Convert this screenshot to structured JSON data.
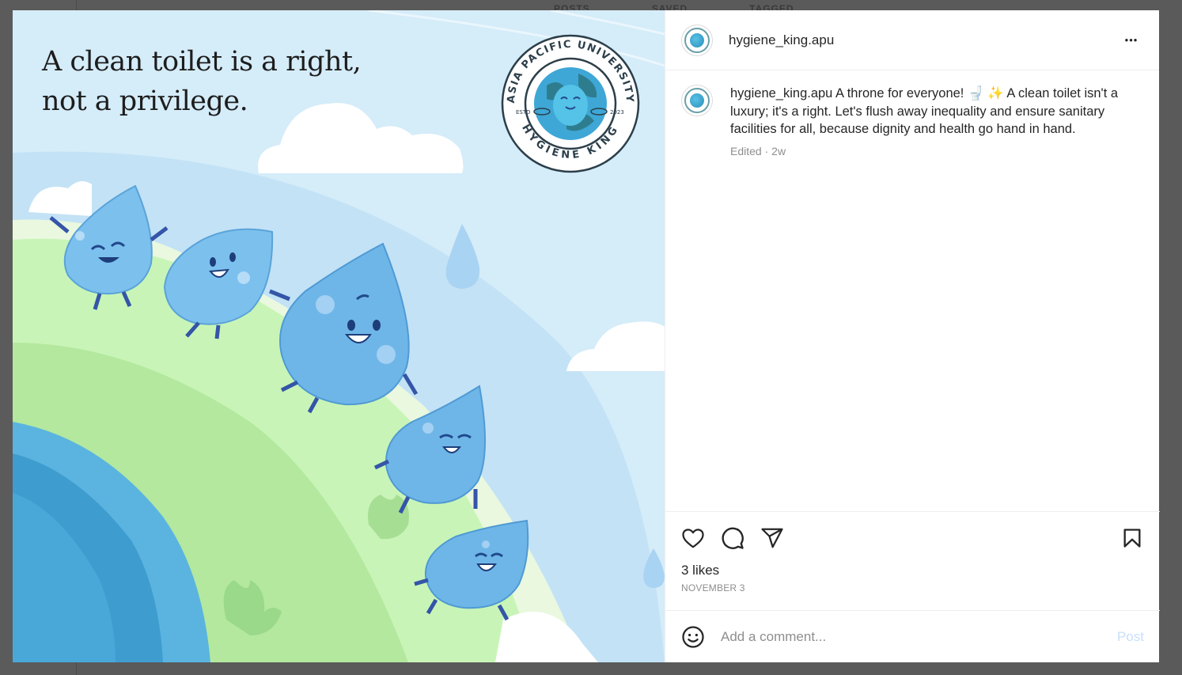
{
  "background": {
    "tabs": [
      "POSTS",
      "SAVED",
      "TAGGED"
    ]
  },
  "post": {
    "image": {
      "headline_line1": "A clean toilet is a right,",
      "headline_line2": "not a privilege.",
      "badge_top_text": "ASIA PACIFIC UNIVERSITY",
      "badge_bottom_text": "HYGIENE KING",
      "badge_left": "ESTD",
      "badge_right": "2023"
    },
    "header": {
      "username": "hygiene_king.apu",
      "more_label": "•••"
    },
    "caption": {
      "username": "hygiene_king.apu",
      "text": " A throne for everyone! 🚽 ✨ A clean toilet isn't a luxury; it's a right. Let's flush away inequality and ensure sanitary facilities for all, because dignity and health go hand in hand.",
      "edited": "Edited",
      "time": "2w"
    },
    "likes": "3 likes",
    "date": "NOVEMBER 3",
    "comment": {
      "placeholder": "Add a comment...",
      "post_label": "Post"
    }
  },
  "colors": {
    "sky": "#d3ebf8",
    "hill_green": "#b8ecb0",
    "drop_blue": "#6fb6e8",
    "post_disabled": "#c7dffb"
  }
}
